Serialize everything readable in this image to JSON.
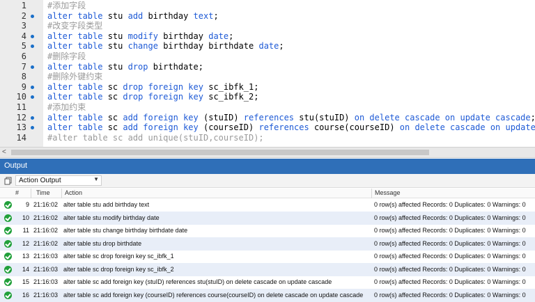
{
  "editor": {
    "lines": [
      {
        "n": "1",
        "dot": false,
        "tokens": [
          {
            "t": "#添加字段",
            "c": "cm"
          }
        ]
      },
      {
        "n": "2",
        "dot": true,
        "tokens": [
          {
            "t": "alter table ",
            "c": "kw"
          },
          {
            "t": "stu ",
            "c": "id"
          },
          {
            "t": "add ",
            "c": "kw"
          },
          {
            "t": "birthday ",
            "c": "id"
          },
          {
            "t": "text",
            "c": "kw"
          },
          {
            "t": ";",
            "c": "id"
          }
        ]
      },
      {
        "n": "3",
        "dot": false,
        "tokens": [
          {
            "t": "#改变字段类型",
            "c": "cm"
          }
        ]
      },
      {
        "n": "4",
        "dot": true,
        "tokens": [
          {
            "t": "alter table ",
            "c": "kw"
          },
          {
            "t": "stu ",
            "c": "id"
          },
          {
            "t": "modify ",
            "c": "kw"
          },
          {
            "t": "birthday ",
            "c": "id"
          },
          {
            "t": "date",
            "c": "kw"
          },
          {
            "t": ";",
            "c": "id"
          }
        ]
      },
      {
        "n": "5",
        "dot": true,
        "tokens": [
          {
            "t": "alter table ",
            "c": "kw"
          },
          {
            "t": "stu ",
            "c": "id"
          },
          {
            "t": "change ",
            "c": "kw"
          },
          {
            "t": "birthday birthdate ",
            "c": "id"
          },
          {
            "t": "date",
            "c": "kw"
          },
          {
            "t": ";",
            "c": "id"
          }
        ]
      },
      {
        "n": "6",
        "dot": false,
        "tokens": [
          {
            "t": "#删除字段",
            "c": "cm"
          }
        ]
      },
      {
        "n": "7",
        "dot": true,
        "tokens": [
          {
            "t": "alter table ",
            "c": "kw"
          },
          {
            "t": "stu ",
            "c": "id"
          },
          {
            "t": "drop ",
            "c": "kw"
          },
          {
            "t": "birthdate;",
            "c": "id"
          }
        ]
      },
      {
        "n": "8",
        "dot": false,
        "tokens": [
          {
            "t": "#删除外键约束",
            "c": "cm"
          }
        ]
      },
      {
        "n": "9",
        "dot": true,
        "tokens": [
          {
            "t": "alter table ",
            "c": "kw"
          },
          {
            "t": "sc ",
            "c": "id"
          },
          {
            "t": "drop foreign key ",
            "c": "kw"
          },
          {
            "t": "sc_ibfk_1;",
            "c": "id"
          }
        ]
      },
      {
        "n": "10",
        "dot": true,
        "tokens": [
          {
            "t": "alter table ",
            "c": "kw"
          },
          {
            "t": "sc ",
            "c": "id"
          },
          {
            "t": "drop foreign key ",
            "c": "kw"
          },
          {
            "t": "sc_ibfk_2;",
            "c": "id"
          }
        ]
      },
      {
        "n": "11",
        "dot": false,
        "tokens": [
          {
            "t": "#添加约束",
            "c": "cm"
          }
        ]
      },
      {
        "n": "12",
        "dot": true,
        "tokens": [
          {
            "t": "alter table ",
            "c": "kw"
          },
          {
            "t": "sc ",
            "c": "id"
          },
          {
            "t": "add foreign key ",
            "c": "kw"
          },
          {
            "t": "(stuID) ",
            "c": "id"
          },
          {
            "t": "references ",
            "c": "kw"
          },
          {
            "t": "stu(stuID) ",
            "c": "id"
          },
          {
            "t": "on delete cascade on update cascade",
            "c": "kw"
          },
          {
            "t": ";",
            "c": "id"
          }
        ]
      },
      {
        "n": "13",
        "dot": true,
        "tokens": [
          {
            "t": "alter table ",
            "c": "kw"
          },
          {
            "t": "sc ",
            "c": "id"
          },
          {
            "t": "add foreign key ",
            "c": "kw"
          },
          {
            "t": "(courseID) ",
            "c": "id"
          },
          {
            "t": "references ",
            "c": "kw"
          },
          {
            "t": "course(courseID) ",
            "c": "id"
          },
          {
            "t": "on delete cascade on update cascade",
            "c": "kw"
          },
          {
            "t": ";",
            "c": "id"
          }
        ]
      },
      {
        "n": "14",
        "dot": false,
        "tokens": [
          {
            "t": "#alter table sc add unique(stuID,courseID);",
            "c": "cm"
          }
        ]
      }
    ]
  },
  "scrollbar": {
    "left_arrow": "<"
  },
  "output": {
    "title": "Output",
    "dropdown_value": "Action Output",
    "columns": {
      "num": "#",
      "time": "Time",
      "action": "Action",
      "message": "Message"
    },
    "rows": [
      {
        "num": "9",
        "time": "21:16:02",
        "action": "alter table stu add birthday text",
        "message": "0 row(s) affected Records: 0  Duplicates: 0  Warnings: 0"
      },
      {
        "num": "10",
        "time": "21:16:02",
        "action": "alter table stu modify birthday date",
        "message": "0 row(s) affected Records: 0  Duplicates: 0  Warnings: 0"
      },
      {
        "num": "11",
        "time": "21:16:02",
        "action": "alter table stu change birthday birthdate date",
        "message": "0 row(s) affected Records: 0  Duplicates: 0  Warnings: 0"
      },
      {
        "num": "12",
        "time": "21:16:02",
        "action": "alter table stu drop birthdate",
        "message": "0 row(s) affected Records: 0  Duplicates: 0  Warnings: 0"
      },
      {
        "num": "13",
        "time": "21:16:03",
        "action": "alter table sc drop foreign key sc_ibfk_1",
        "message": "0 row(s) affected Records: 0  Duplicates: 0  Warnings: 0"
      },
      {
        "num": "14",
        "time": "21:16:03",
        "action": "alter table sc drop foreign key sc_ibfk_2",
        "message": "0 row(s) affected Records: 0  Duplicates: 0  Warnings: 0"
      },
      {
        "num": "15",
        "time": "21:16:03",
        "action": "alter table sc add foreign key (stuID) references stu(stuID) on delete cascade on update cascade",
        "message": "0 row(s) affected Records: 0  Duplicates: 0  Warnings: 0"
      },
      {
        "num": "16",
        "time": "21:16:03",
        "action": "alter table sc add foreign key (courseID) references course(courseID) on delete cascade on update cascade",
        "message": "0 row(s) affected Records: 0  Duplicates: 0  Warnings: 0"
      }
    ]
  },
  "colors": {
    "header_blue": "#2f6fb8",
    "keyword": "#1e5ad6",
    "comment": "#9a9a9a",
    "success": "#21a03a"
  }
}
